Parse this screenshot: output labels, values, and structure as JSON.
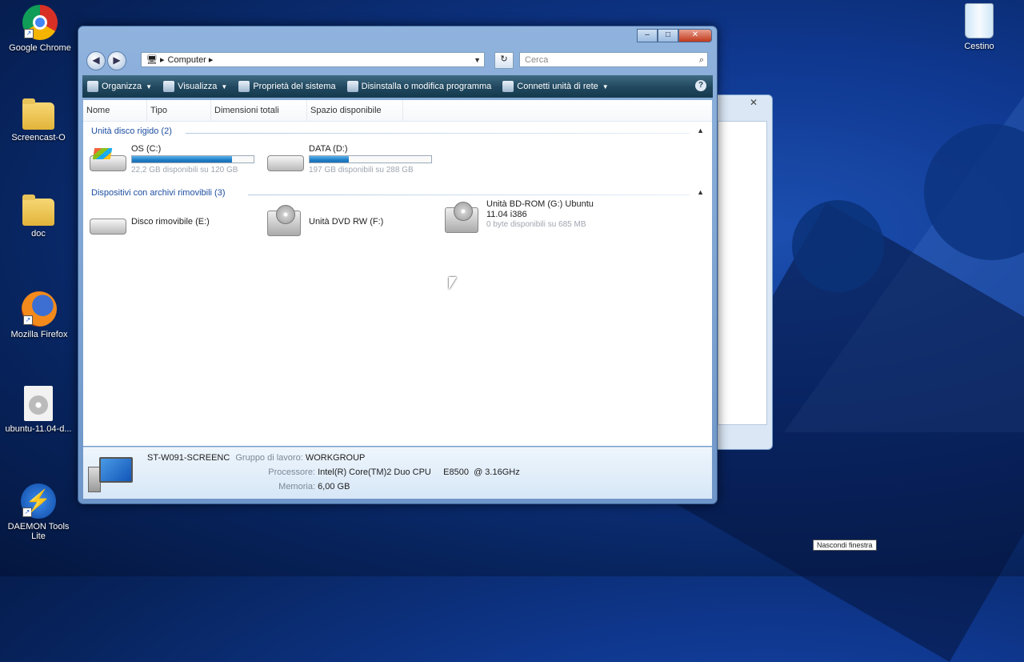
{
  "desktop": {
    "icons": [
      {
        "label": "Google Chrome"
      },
      {
        "label": "Screencast-O"
      },
      {
        "label": "doc"
      },
      {
        "label": "Mozilla Firefox"
      },
      {
        "label": "ubuntu-11.04-d..."
      },
      {
        "label": "DAEMON Tools Lite"
      },
      {
        "label": "Cestino"
      }
    ],
    "tooltip": "Nascondi finestra"
  },
  "window": {
    "address": {
      "crumb": "Computer"
    },
    "search": {
      "placeholder": "Cerca"
    },
    "toolbar": [
      {
        "label": "Organizza",
        "dropdown": true
      },
      {
        "label": "Visualizza",
        "dropdown": true
      },
      {
        "label": "Proprietà del sistema",
        "dropdown": false
      },
      {
        "label": "Disinstalla o modifica programma",
        "dropdown": false
      },
      {
        "label": "Connetti unità di rete",
        "dropdown": true
      }
    ],
    "columns": [
      "Nome",
      "Tipo",
      "Dimensioni totali",
      "Spazio disponibile"
    ],
    "groups": [
      {
        "title": "Unità disco rigido (2)"
      },
      {
        "title": "Dispositivi con archivi rimovibili (3)"
      }
    ],
    "hard_disks": [
      {
        "name": "OS (C:)",
        "free": "22,2 GB disponibili su 120 GB",
        "used_fraction": 0.82
      },
      {
        "name": "DATA (D:)",
        "free": "197 GB disponibili su 288 GB",
        "used_fraction": 0.32
      }
    ],
    "removable": [
      {
        "name": "Disco rimovibile (E:)"
      },
      {
        "name": "Unità DVD RW (F:)"
      },
      {
        "name": "Unità BD-ROM (G:) Ubuntu",
        "name2": "11.04 i386",
        "free": "0 byte disponibili su 685 MB"
      }
    ],
    "details": {
      "computer_name": "ST-W091-SCREENC",
      "workgroup_label": "Gruppo di lavoro:",
      "workgroup": "WORKGROUP",
      "processor_label": "Processore:",
      "processor": "Intel(R) Core(TM)2 Duo CPU     E8500  @ 3.16GHz",
      "memory_label": "Memoria:",
      "memory": "6,00 GB"
    }
  },
  "colors": {
    "desktop": "#0f3890",
    "progress": "#1c7cc7",
    "toolbar": "#20475e"
  }
}
